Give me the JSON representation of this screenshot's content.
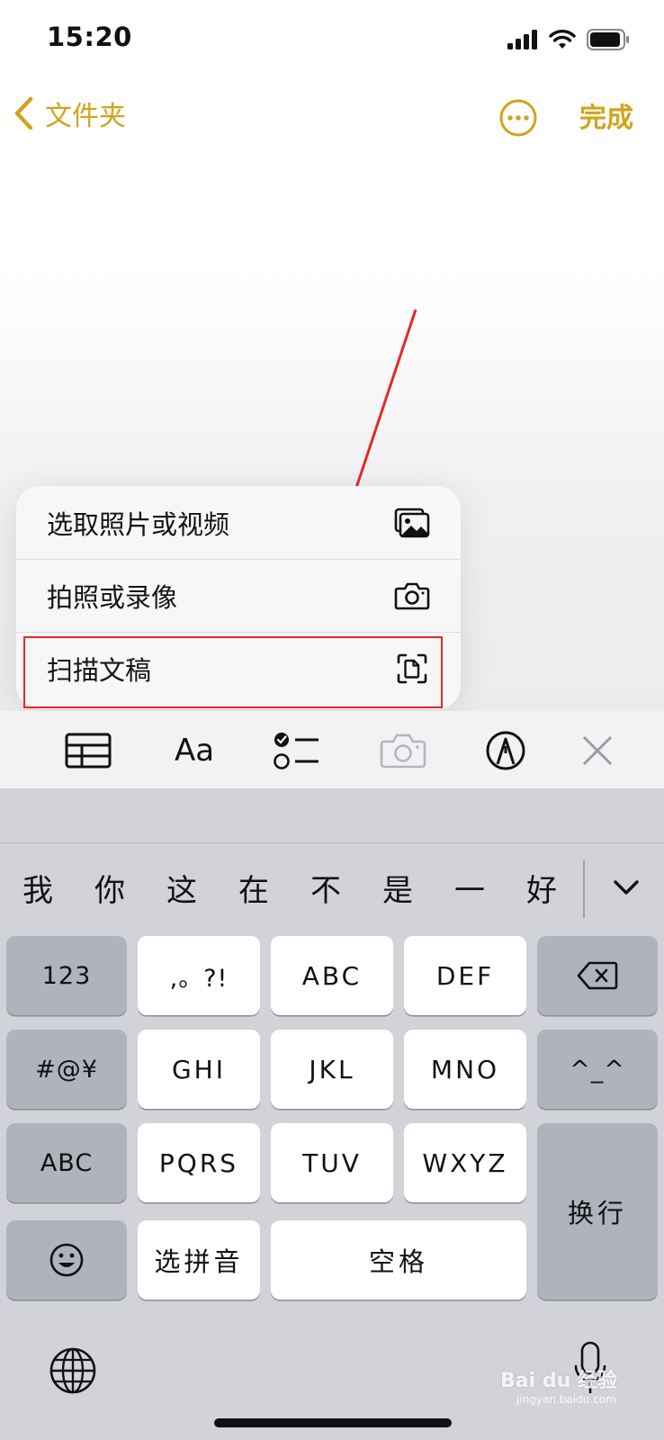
{
  "status_bar": {
    "time": "15:20"
  },
  "nav": {
    "back_label": "文件夹",
    "done_label": "完成"
  },
  "menu": {
    "items": [
      {
        "label": "选取照片或视频",
        "icon": "photo-library-icon"
      },
      {
        "label": "拍照或录像",
        "icon": "camera-icon"
      },
      {
        "label": "扫描文稿",
        "icon": "scan-document-icon"
      }
    ],
    "highlight_color": "#e8262a"
  },
  "toolbar": {
    "format_label": "Aa",
    "icons": [
      "table-icon",
      "format-text-icon",
      "checklist-icon",
      "camera-icon",
      "markup-pen-icon",
      "close-icon"
    ]
  },
  "keyboard": {
    "candidates": [
      "我",
      "你",
      "这",
      "在",
      "不",
      "是",
      "一",
      "好"
    ],
    "keys": {
      "num": "123",
      "punct": ",。?!",
      "abc": "ABC",
      "def": "DEF",
      "sym": "#@¥",
      "ghi": "GHI",
      "jkl": "JKL",
      "mno": "MNO",
      "emoticon": "^_^",
      "abc_mode": "ABC",
      "pqrs": "PQRS",
      "tuv": "TUV",
      "wxyz": "WXYZ",
      "return": "换行",
      "pinyin": "选拼音",
      "space": "空格"
    }
  },
  "watermark": {
    "brand": "Bai du 经验",
    "url": "jingyan.baidu.com"
  },
  "colors": {
    "accent": "#d2a41c",
    "keyboard_bg": "#d1d3d9"
  }
}
